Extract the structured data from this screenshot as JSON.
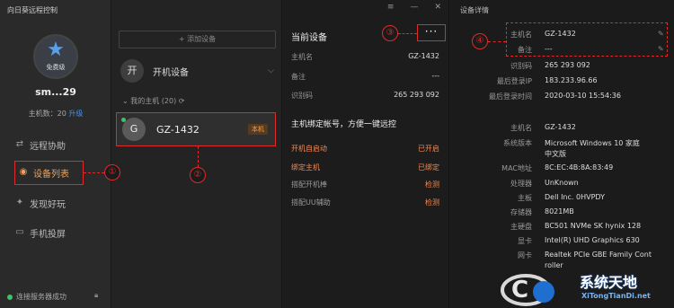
{
  "app_title": "向日葵远程控制",
  "sidebar": {
    "badge": "免费级",
    "username": "sm...29",
    "host_label": "主机数：20",
    "upgrade": "升级",
    "nav": [
      {
        "label": "远程协助",
        "icon": "remote-assist-icon"
      },
      {
        "label": "设备列表",
        "icon": "device-list-icon"
      },
      {
        "label": "发现好玩",
        "icon": "discover-icon"
      },
      {
        "label": "手机投屏",
        "icon": "screen-cast-icon"
      }
    ],
    "status": "连接服务器成功"
  },
  "device_list": {
    "add_button": "+ 添加设备",
    "group_avatar": "开",
    "group_label": "开机设备",
    "my_hosts": "我的主机 (20)",
    "device_avatar": "G",
    "device_name": "GZ-1432",
    "device_tag": "本机"
  },
  "current_device": {
    "title": "当前设备",
    "more": "···",
    "rows": [
      {
        "k": "主机名",
        "v": "GZ-1432"
      },
      {
        "k": "备注",
        "v": "---"
      },
      {
        "k": "识别码",
        "v": "265 293 092"
      }
    ],
    "bind_title": "主机绑定帐号，方便一键远控",
    "actions": [
      {
        "k": "开机自启动",
        "v": "已开启"
      },
      {
        "k": "绑定主机",
        "v": "已绑定"
      },
      {
        "k": "搭配开机棒",
        "v": "检测"
      },
      {
        "k": "搭配UU辅助",
        "v": "检测"
      }
    ]
  },
  "details": {
    "title": "设备详情",
    "rows1": [
      {
        "k": "主机名",
        "v": "GZ-1432"
      },
      {
        "k": "备注",
        "v": "---"
      },
      {
        "k": "识别码",
        "v": "265 293 092"
      },
      {
        "k": "最后登录IP",
        "v": "183.233.96.66"
      },
      {
        "k": "最后登录时间",
        "v": "2020-03-10 15:54:36"
      }
    ],
    "rows2": [
      {
        "k": "主机名",
        "v": "GZ-1432"
      },
      {
        "k": "系统版本",
        "v": "Microsoft Windows 10 家庭"
      },
      {
        "k": "",
        "v": "中文版"
      },
      {
        "k": "MAC地址",
        "v": "8C:EC:4B:8A:83:49"
      },
      {
        "k": "处理器",
        "v": "UnKnown"
      },
      {
        "k": "主板",
        "v": "Dell Inc. 0HVPDY"
      },
      {
        "k": "存储器",
        "v": "8021MB"
      },
      {
        "k": "主硬盘",
        "v": "BC501 NVMe SK hynix 128"
      },
      {
        "k": "显卡",
        "v": "Intel(R) UHD Graphics 630"
      },
      {
        "k": "网卡",
        "v": "Realtek PCIe GBE Family Cont"
      },
      {
        "k": "",
        "v": "roller"
      }
    ]
  },
  "annotations": [
    "①",
    "②",
    "③",
    "④"
  ],
  "watermark": {
    "text": "系统天地",
    "sub": "XiTongTianDi.net"
  }
}
